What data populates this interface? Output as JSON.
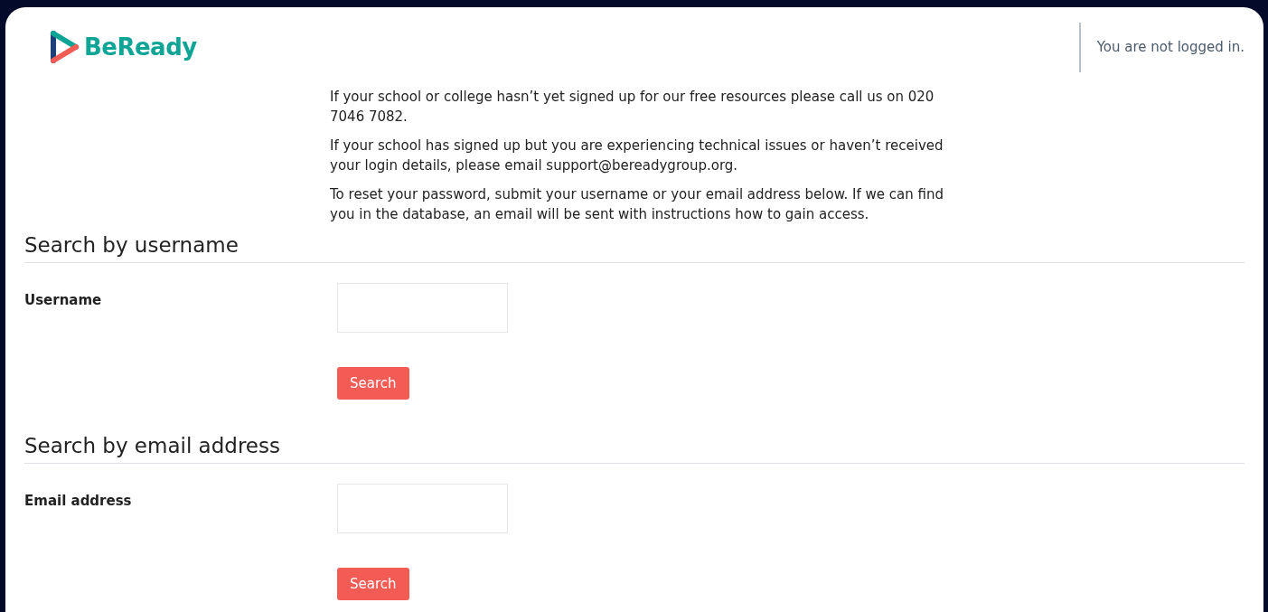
{
  "header": {
    "logo_text": "BeReady",
    "login_status": "You are not logged in."
  },
  "intro": [
    "If your school or college hasn’t yet signed up for our free resources please call us on 020 7046 7082.",
    "If your school has signed up but you are experiencing technical issues or haven’t received your login details, please email support@bereadygroup.org.",
    "To reset your password, submit your username or your email address below. If we can find you in the database, an email will be sent with instructions how to gain access."
  ],
  "sections": [
    {
      "heading": "Search by username",
      "field_label": "Username",
      "button": "Search"
    },
    {
      "heading": "Search by email address",
      "field_label": "Email address",
      "button": "Search"
    }
  ]
}
